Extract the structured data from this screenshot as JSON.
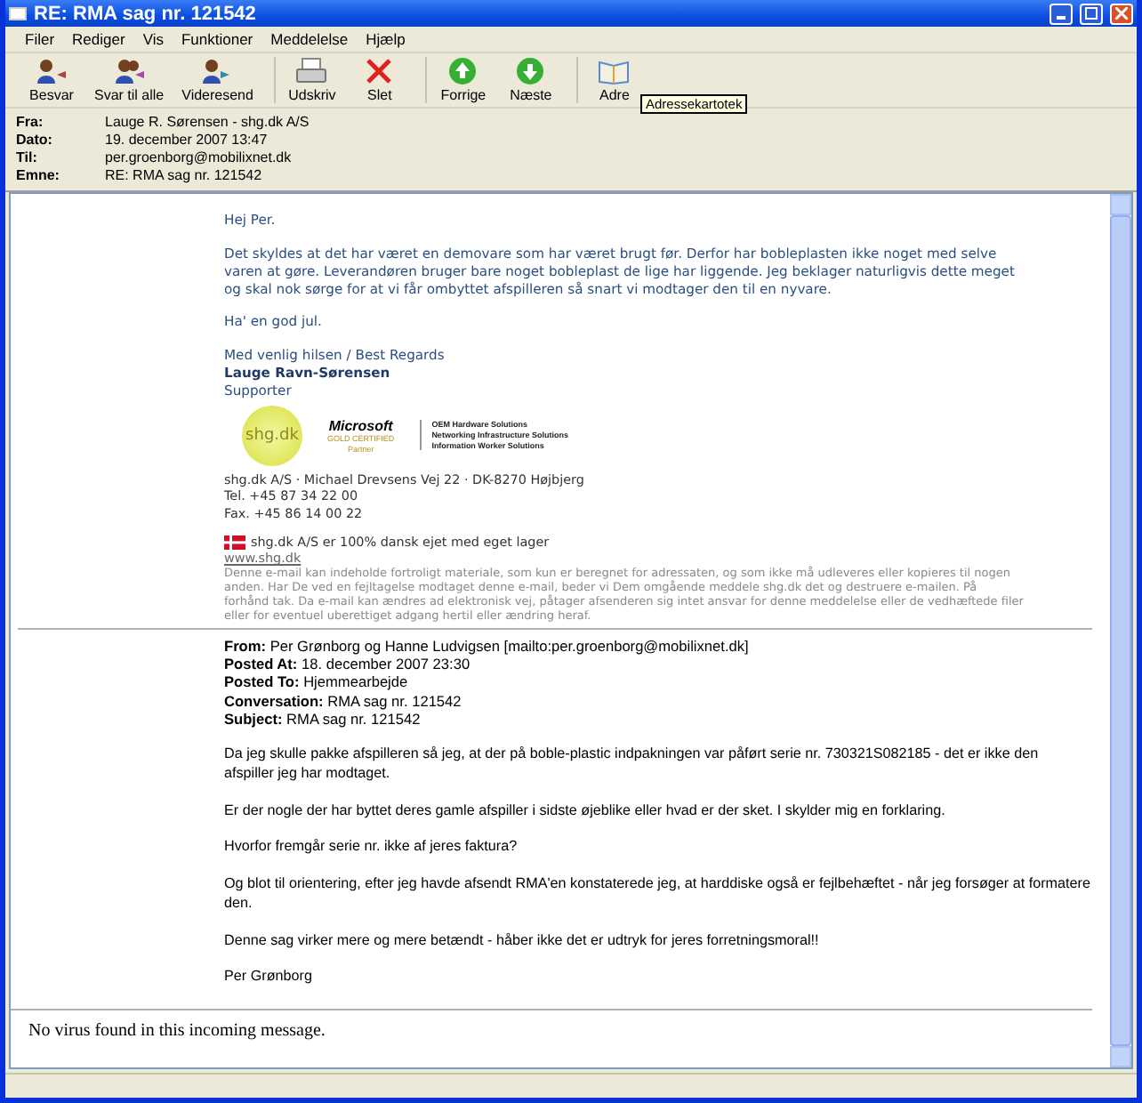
{
  "window": {
    "title": "RE: RMA sag nr. 121542"
  },
  "menu": [
    {
      "label": "Filer"
    },
    {
      "label": "Rediger"
    },
    {
      "label": "Vis"
    },
    {
      "label": "Funktioner"
    },
    {
      "label": "Meddelelse"
    },
    {
      "label": "Hjælp"
    }
  ],
  "toolbar": [
    {
      "label": "Besvar",
      "kind": "reply"
    },
    {
      "label": "Svar til alle",
      "kind": "replyall"
    },
    {
      "label": "Videresend",
      "kind": "forward"
    },
    {
      "label": "Udskriv",
      "kind": "print",
      "group_start": true
    },
    {
      "label": "Slet",
      "kind": "delete"
    },
    {
      "label": "Forrige",
      "kind": "up",
      "group_start": true
    },
    {
      "label": "Næste",
      "kind": "down"
    },
    {
      "label": "Adre",
      "kind": "book",
      "group_start": true
    }
  ],
  "tooltip": "Adressekartotek",
  "header": [
    {
      "label": "Fra:",
      "value": "Lauge R. Sørensen - shg.dk A/S"
    },
    {
      "label": "Dato:",
      "value": "19. december 2007 13:47"
    },
    {
      "label": "Til:",
      "value": "per.groenborg@mobilixnet.dk"
    },
    {
      "label": "Emne:",
      "value": "RE: RMA sag nr. 121542"
    }
  ],
  "reply": {
    "greeting": "Hej Per.",
    "paragraph": [
      "Det skyldes at det har været en demovare som har været brugt før. Derfor har bobleplasten ikke noget med selve",
      "varen at gøre. Leverandøren bruger bare noget bobleplast de lige har liggende. Jeg beklager naturligvis dette meget",
      "og skal nok sørge for at vi får ombyttet afspilleren så snart vi modtager den til en nyvare."
    ],
    "closing": "Ha' en god jul.",
    "regards": "Med venlig hilsen / Best Regards",
    "name": "Lauge Ravn-Sørensen",
    "role": "Supporter",
    "logo_text": "shg.dk",
    "ms_logo": [
      "Microsoft",
      "GOLD CERTIFIED",
      "Partner"
    ],
    "ms_areas": [
      "OEM Hardware Solutions",
      "Networking Infrastructure Solutions",
      "Information Worker Solutions"
    ],
    "address": [
      "shg.dk A/S · Michael Drevsens Vej 22 · DK-8270 Højbjerg",
      "Tel. +45 87 34 22 00",
      "Fax. +45 86 14 00 22"
    ],
    "danish": "shg.dk A/S er 100% dansk ejet med eget lager",
    "link": "www.shg.dk",
    "disclaimer": [
      "Denne e-mail kan indeholde fortroligt materiale, som kun er beregnet for adressaten, og som ikke må udleveres eller kopieres til nogen",
      "anden. Har De ved en fejltagelse modtaget denne e-mail, beder vi Dem omgående meddele shg.dk det og destruere e-mailen. På",
      "forhånd tak. Da e-mail kan ændres ad elektronisk vej, påtager afsenderen sig intet ansvar for denne meddelelse eller de vedhæftede filer",
      "eller for eventuel uberettiget adgang hertil eller ændring heraf."
    ]
  },
  "quoted": {
    "fields": [
      {
        "label": "From:",
        "value": "Per Grønborg og Hanne Ludvigsen [mailto:per.groenborg@mobilixnet.dk]"
      },
      {
        "label": "Posted At:",
        "value": "18. december 2007 23:30"
      },
      {
        "label": "Posted To:",
        "value": "Hjemmearbejde"
      },
      {
        "label": "Conversation:",
        "value": "RMA sag nr. 121542"
      },
      {
        "label": "Subject:",
        "value": "RMA sag nr. 121542"
      }
    ],
    "paragraphs": [
      [
        "Da jeg skulle pakke afspilleren så jeg, at der på boble-plastic indpakningen var påført serie nr. 730321S082185 - det er ikke den",
        "afspiller jeg har modtaget."
      ],
      [
        "Er der nogle der har byttet deres gamle afspiller i sidste øjeblike eller hvad er der sket. I skylder mig en forklaring."
      ],
      [
        "Hvorfor fremgår serie nr. ikke af jeres faktura?"
      ],
      [
        "Og blot til orientering, efter jeg havde afsendt RMA'en konstaterede jeg, at harddiske også er fejlbehæftet - når jeg forsøger at formatere",
        "den."
      ],
      [
        "Denne sag virker mere og mere betændt - håber ikke det er udtryk for jeres forretningsmoral!!"
      ],
      [
        "Per Grønborg"
      ]
    ]
  },
  "footer": "No virus found in this incoming message."
}
